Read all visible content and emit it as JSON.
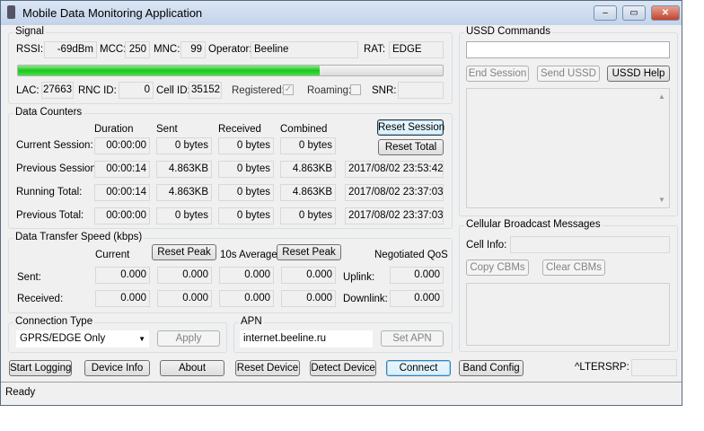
{
  "window": {
    "title": "Mobile Data Monitoring Application",
    "minimize": "–",
    "maximize": "▭",
    "close": "✕"
  },
  "signal": {
    "group": "Signal",
    "rssi_label": "RSSI:",
    "rssi": "-69dBm",
    "mcc_label": "MCC:",
    "mcc": "250",
    "mnc_label": "MNC:",
    "mnc": "99",
    "operator_label": "Operator:",
    "operator": "Beeline",
    "rat_label": "RAT:",
    "rat": "EDGE",
    "signal_percent": 71,
    "lac_label": "LAC:",
    "lac": "27663",
    "rnc_label": "RNC ID:",
    "rnc": "0",
    "cell_label": "Cell ID:",
    "cell": "35152",
    "registered_label": "Registered:",
    "registered": true,
    "roaming_label": "Roaming:",
    "roaming": false,
    "snr_label": "SNR:",
    "snr": ""
  },
  "counters": {
    "group": "Data Counters",
    "headers": [
      "Duration",
      "Sent",
      "Received",
      "Combined"
    ],
    "reset_session": "Reset Session",
    "reset_total": "Reset Total",
    "rows": [
      {
        "label": "Current Session:",
        "duration": "00:00:00",
        "sent": "0 bytes",
        "received": "0 bytes",
        "combined": "0 bytes",
        "date": ""
      },
      {
        "label": "Previous Session:",
        "duration": "00:00:14",
        "sent": "4.863KB",
        "received": "0 bytes",
        "combined": "4.863KB",
        "date": "2017/08/02 23:53:42"
      },
      {
        "label": "Running Total:",
        "duration": "00:00:14",
        "sent": "4.863KB",
        "received": "0 bytes",
        "combined": "4.863KB",
        "date": "2017/08/02 23:37:03"
      },
      {
        "label": "Previous Total:",
        "duration": "00:00:00",
        "sent": "0 bytes",
        "received": "0 bytes",
        "combined": "0 bytes",
        "date": "2017/08/02 23:37:03"
      }
    ]
  },
  "speed": {
    "group": "Data Transfer Speed (kbps)",
    "current": "Current",
    "reset_peak": "Reset Peak",
    "avg": "10s Average",
    "reset_peak2": "Reset Peak",
    "qos": "Negotiated QoS",
    "sent_label": "Sent:",
    "received_label": "Received:",
    "uplink_label": "Uplink:",
    "downlink_label": "Downlink:",
    "sent": [
      "0.000",
      "0.000",
      "0.000",
      "0.000"
    ],
    "received": [
      "0.000",
      "0.000",
      "0.000",
      "0.000"
    ],
    "uplink": "0.000",
    "downlink": "0.000"
  },
  "connection": {
    "group": "Connection Type",
    "selected": "GPRS/EDGE Only",
    "apply": "Apply"
  },
  "apn": {
    "group": "APN",
    "value": "internet.beeline.ru",
    "set": "Set APN"
  },
  "buttons": [
    "Start Logging",
    "Device Info",
    "About",
    "Reset Device",
    "Detect Device",
    "Connect",
    "Band Config"
  ],
  "ltersrp": {
    "label": "^LTERSRP:",
    "value": ""
  },
  "status": "Ready",
  "ussd": {
    "group": "USSD Commands",
    "input": "",
    "end": "End Session",
    "send": "Send USSD",
    "help": "USSD Help"
  },
  "cbm": {
    "group": "Cellular Broadcast Messages",
    "cell_info_label": "Cell Info:",
    "cell_info": "",
    "copy": "Copy CBMs",
    "clear": "Clear CBMs"
  }
}
